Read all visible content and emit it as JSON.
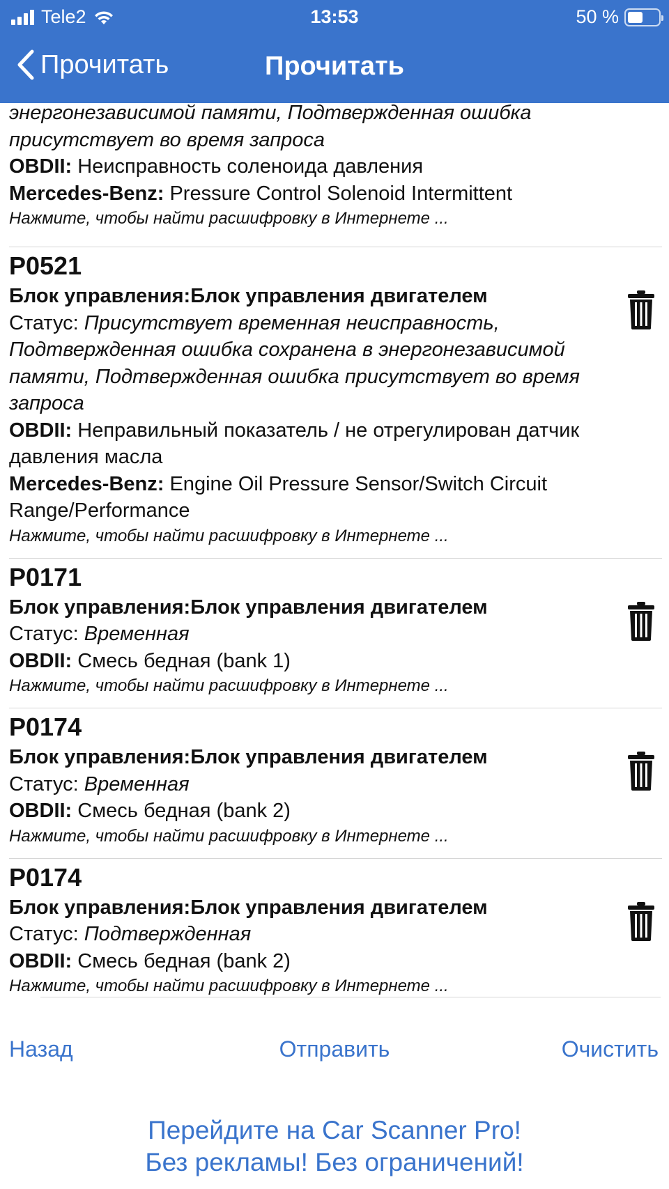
{
  "status_bar": {
    "carrier": "Tele2",
    "time": "13:53",
    "battery_text": "50 %",
    "battery_level": 0.5
  },
  "nav": {
    "back_label": "Прочитать",
    "title": "Прочитать"
  },
  "partial_item": {
    "status_line1": "энергонезависимой памяти, Подтвержденная ошибка",
    "status_line2": "присутствует во время запроса",
    "obd_label": "OBDII:",
    "obd_text": "Неисправность соленоида давления",
    "mb_label": "Mercedes-Benz:",
    "mb_text": "Pressure Control Solenoid Intermittent",
    "hint": "Нажмите, чтобы найти расшифровку в Интернете ..."
  },
  "items": [
    {
      "code": "P0521",
      "module": "Блок управления:Блок управления двигателем",
      "status_label": "Статус:",
      "status_value": "Присутствует временная неисправность, Подтвержденная ошибка сохранена в энергонезависимой памяти, Подтвержденная ошибка присутствует во время запроса",
      "obd_label": "OBDII:",
      "obd_text": "Неправильный показатель / не отрегулирован датчик давления масла",
      "mb_label": "Mercedes-Benz:",
      "mb_text": "Engine Oil Pressure Sensor/Switch Circuit Range/Performance",
      "hint": "Нажмите, чтобы найти расшифровку в Интернете ..."
    },
    {
      "code": "P0171",
      "module": "Блок управления:Блок управления двигателем",
      "status_label": "Статус:",
      "status_value": "Временная",
      "obd_label": "OBDII:",
      "obd_text": "Смесь бедная (bank 1)",
      "hint": "Нажмите, чтобы найти расшифровку в Интернете ..."
    },
    {
      "code": "P0174",
      "module": "Блок управления:Блок управления двигателем",
      "status_label": "Статус:",
      "status_value": "Временная",
      "obd_label": "OBDII:",
      "obd_text": "Смесь бедная (bank 2)",
      "hint": "Нажмите, чтобы найти расшифровку в Интернете ..."
    },
    {
      "code": "P0174",
      "module": "Блок управления:Блок управления двигателем",
      "status_label": "Статус:",
      "status_value": "Подтвержденная",
      "obd_label": "OBDII:",
      "obd_text": "Смесь бедная (bank 2)",
      "hint": "Нажмите, чтобы найти расшифровку в Интернете ..."
    }
  ],
  "actions": {
    "back": "Назад",
    "send": "Отправить",
    "clear": "Очистить"
  },
  "promo": {
    "line1": "Перейдите на Car Scanner Pro!",
    "line2": "Без рекламы! Без ограничений!"
  },
  "colors": {
    "accent": "#3a74cc",
    "separator": "#d6d6d6",
    "text": "#111111"
  },
  "icons": {
    "trash": "trash-icon",
    "back": "chevron-left-icon",
    "wifi": "wifi-icon",
    "signal": "signal-icon",
    "battery": "battery-icon"
  }
}
